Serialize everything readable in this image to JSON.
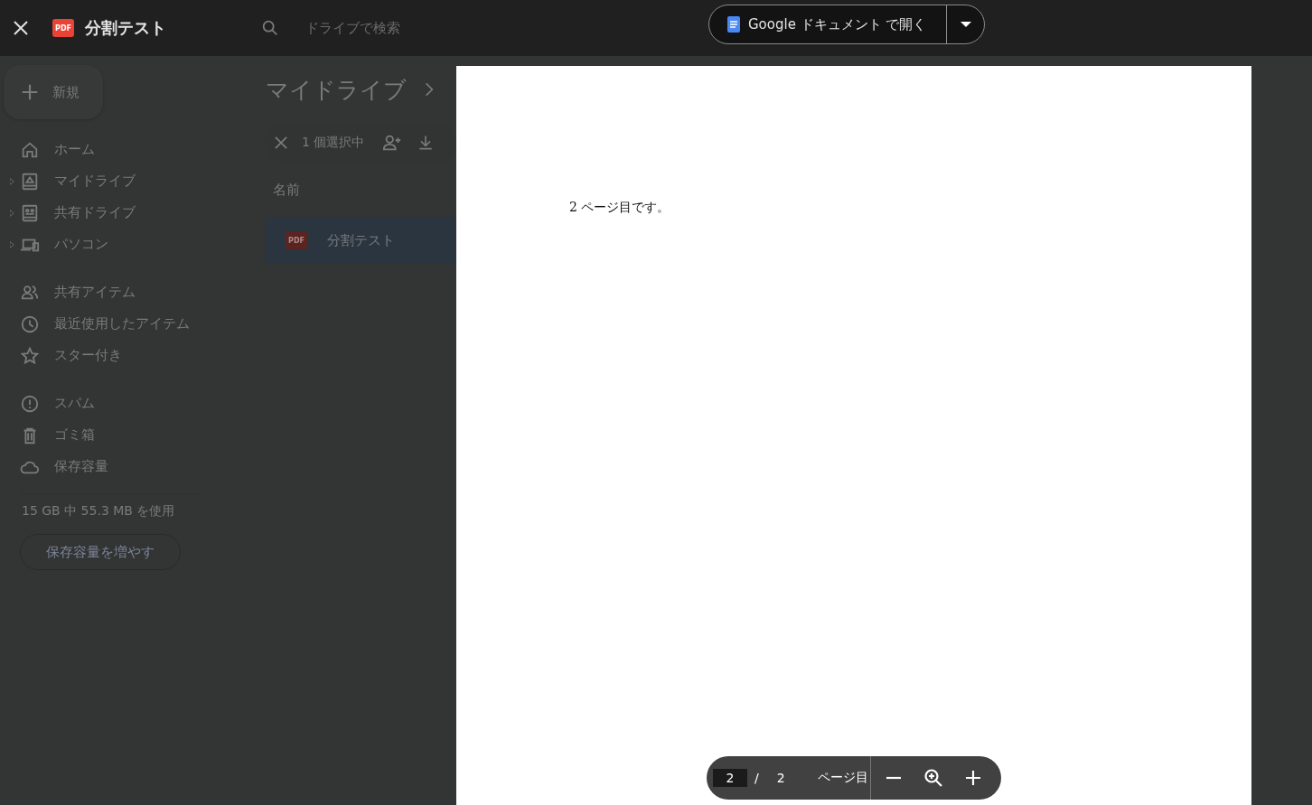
{
  "drive": {
    "search_placeholder": "ドライブで検索",
    "new_button": "新規",
    "nav_groups": [
      [
        {
          "label": "ホーム",
          "expandable": false
        },
        {
          "label": "マイドライブ",
          "expandable": true
        },
        {
          "label": "共有ドライブ",
          "expandable": true
        },
        {
          "label": "パソコン",
          "expandable": true
        }
      ],
      [
        {
          "label": "共有アイテム",
          "expandable": false
        },
        {
          "label": "最近使用したアイテム",
          "expandable": false
        },
        {
          "label": "スター付き",
          "expandable": false
        }
      ],
      [
        {
          "label": "スパム",
          "expandable": false
        },
        {
          "label": "ゴミ箱",
          "expandable": false
        },
        {
          "label": "保存容量",
          "expandable": false
        }
      ]
    ],
    "storage_text": "15 GB 中 55.3 MB を使用",
    "storage_button": "保存容量を増やす",
    "breadcrumb": "マイドライブ",
    "selection": "1 個選択中",
    "column": "名前",
    "rows": [
      {
        "badge": "PDF",
        "name": "分割テスト",
        "selected": true
      }
    ]
  },
  "viewer": {
    "title": "分割テスト",
    "file_badge": "PDF",
    "open_button": "Google ドキュメント で開く",
    "page_text": "2 ページ目です。",
    "pager": {
      "current": "2",
      "separator": "/",
      "total": "2",
      "label": "ページ目"
    }
  }
}
